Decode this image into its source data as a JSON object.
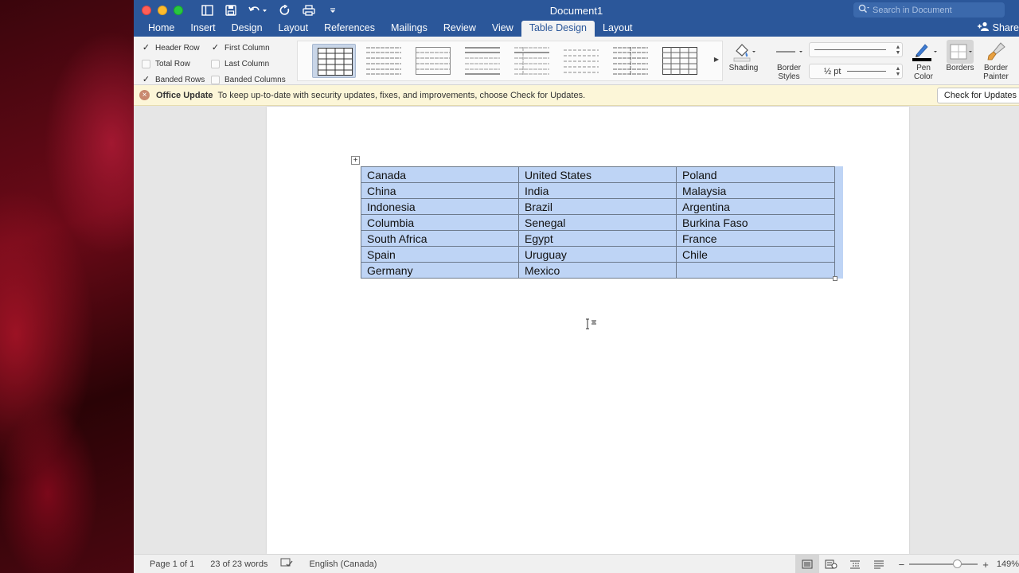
{
  "window": {
    "title": "Document1",
    "search_placeholder": "Search in Document"
  },
  "tabs": [
    {
      "label": "Home",
      "active": false
    },
    {
      "label": "Insert",
      "active": false
    },
    {
      "label": "Design",
      "active": false
    },
    {
      "label": "Layout",
      "active": false
    },
    {
      "label": "References",
      "active": false
    },
    {
      "label": "Mailings",
      "active": false
    },
    {
      "label": "Review",
      "active": false
    },
    {
      "label": "View",
      "active": false
    },
    {
      "label": "Table Design",
      "active": true
    },
    {
      "label": "Layout",
      "active": false
    }
  ],
  "share_label": "Share",
  "style_options": {
    "header_row": {
      "label": "Header Row",
      "checked": true
    },
    "first_column": {
      "label": "First Column",
      "checked": true
    },
    "total_row": {
      "label": "Total Row",
      "checked": false
    },
    "last_column": {
      "label": "Last Column",
      "checked": false
    },
    "banded_rows": {
      "label": "Banded Rows",
      "checked": true
    },
    "banded_columns": {
      "label": "Banded Columns",
      "checked": false
    }
  },
  "ribbon": {
    "shading_label": "Shading",
    "border_styles_label": "Border\nStyles",
    "line_weight": "½ pt",
    "pen_color_label": "Pen\nColor",
    "borders_label": "Borders",
    "border_painter_label": "Border\nPainter",
    "pen_color": "#000000"
  },
  "message_bar": {
    "title": "Office Update",
    "text": "To keep up-to-date with security updates, fixes, and improvements, choose Check for Updates.",
    "button_label": "Check for Updates"
  },
  "table": {
    "rows": [
      [
        "Canada",
        "United States",
        "Poland"
      ],
      [
        "China",
        "India",
        "Malaysia"
      ],
      [
        "Indonesia",
        "Brazil",
        "Argentina"
      ],
      [
        "Columbia",
        "Senegal",
        "Burkina Faso"
      ],
      [
        "South Africa",
        "Egypt",
        "France"
      ],
      [
        "Spain",
        "Uruguay",
        "Chile"
      ],
      [
        "Germany",
        "Mexico",
        ""
      ]
    ]
  },
  "status": {
    "page": "Page 1 of 1",
    "words": "23 of 23 words",
    "language": "English (Canada)",
    "zoom": "149%"
  },
  "colors": {
    "title_bar": "#2b579a",
    "selection": "#bed4f5"
  }
}
